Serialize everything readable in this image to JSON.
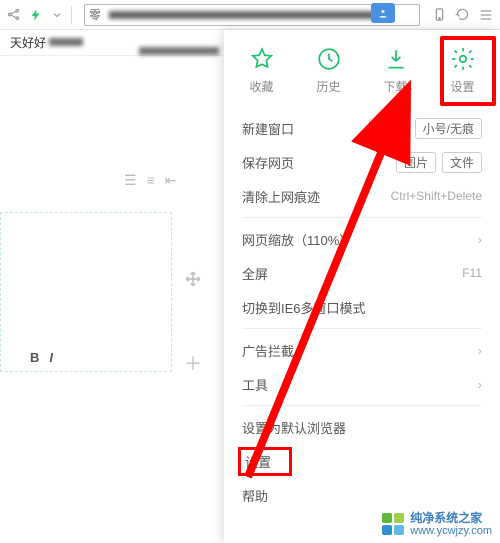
{
  "topbar": {
    "bolt_color": "#2ecc71",
    "url_prefix": "零",
    "url_tag_icon": "person-icon"
  },
  "tabbar": {
    "text1_prefix": "天好好",
    "text2_prefix": ""
  },
  "panel": {
    "quick": [
      {
        "label": "收藏",
        "icon": "star-icon"
      },
      {
        "label": "历史",
        "icon": "clock-icon"
      },
      {
        "label": "下载",
        "icon": "download-icon"
      },
      {
        "label": "设置",
        "icon": "gear-icon"
      }
    ],
    "menu": {
      "new_window": {
        "label": "新建窗口",
        "pills": [
          "普通",
          "小号/无痕"
        ]
      },
      "save_page": {
        "label": "保存网页",
        "pills": [
          "图片",
          "文件"
        ]
      },
      "clear_trace": {
        "label": "清除上网痕迹",
        "shortcut": "Ctrl+Shift+Delete"
      },
      "zoom": {
        "label": "网页缩放（110%）"
      },
      "fullscreen": {
        "label": "全屏",
        "shortcut": "F11"
      },
      "ie6mode": {
        "label": "切换到IE6多窗口模式"
      },
      "adblock": {
        "label": "广告拦截"
      },
      "tools": {
        "label": "工具"
      },
      "set_default": {
        "label": "设置为默认浏览器"
      },
      "settings": {
        "label": "设置"
      },
      "help": {
        "label": "帮助"
      }
    }
  },
  "watermark": {
    "title": "纯净系统之家",
    "url": "www.ycwjzy.com"
  }
}
